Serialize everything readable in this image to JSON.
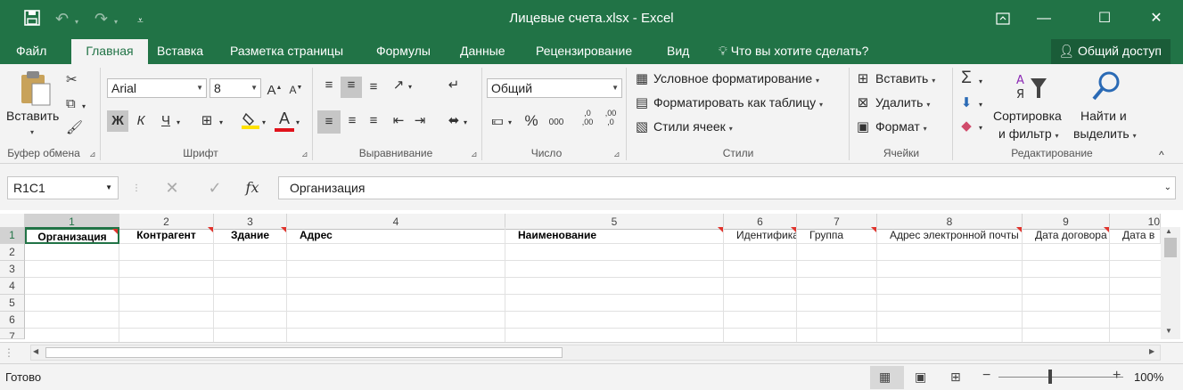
{
  "window": {
    "title": "Лицевые счета.xlsx - Excel"
  },
  "tabs": [
    "Файл",
    "Главная",
    "Вставка",
    "Разметка страницы",
    "Формулы",
    "Данные",
    "Рецензирование",
    "Вид"
  ],
  "tellme": "Что вы хотите сделать?",
  "share": "Общий доступ",
  "ribbon": {
    "clipboard": {
      "paste": "Вставить",
      "label": "Буфер обмена"
    },
    "font": {
      "name": "Arial",
      "size": "8",
      "bold": "Ж",
      "italic": "К",
      "underline": "Ч",
      "grow": "A",
      "shrink": "A",
      "color_letter": "A",
      "label": "Шрифт"
    },
    "alignment": {
      "label": "Выравнивание"
    },
    "number": {
      "format": "Общий",
      "percent": "%",
      "thousands": "000",
      "inc": ",0\n,00",
      "dec": ",00\n,0",
      "label": "Число"
    },
    "styles": {
      "conditional": "Условное форматирование",
      "table": "Форматировать как таблицу",
      "cell_styles": "Стили ячеек",
      "label": "Стили"
    },
    "cells": {
      "insert": "Вставить",
      "delete": "Удалить",
      "format": "Формат",
      "label": "Ячейки"
    },
    "editing": {
      "sort": "Сортировка",
      "sort2": "и фильтр",
      "find": "Найти и",
      "find2": "выделить",
      "sum": "Σ",
      "label": "Редактирование"
    }
  },
  "formula_bar": {
    "namebox": "R1C1",
    "value": "Организация",
    "fx": "fx"
  },
  "columns": [
    "1",
    "2",
    "3",
    "4",
    "5",
    "6",
    "7",
    "8",
    "9",
    "10"
  ],
  "rows": [
    "1",
    "2",
    "3",
    "4",
    "5",
    "6",
    "7"
  ],
  "headers": [
    "Организация",
    "Контрагент",
    "Здание",
    "Адрес",
    "Наименование",
    "Идентификатор",
    "Группа",
    "Адрес электронной почты",
    "Дата договора",
    "Дата в"
  ],
  "status": {
    "ready": "Готово",
    "zoom": "100%"
  }
}
